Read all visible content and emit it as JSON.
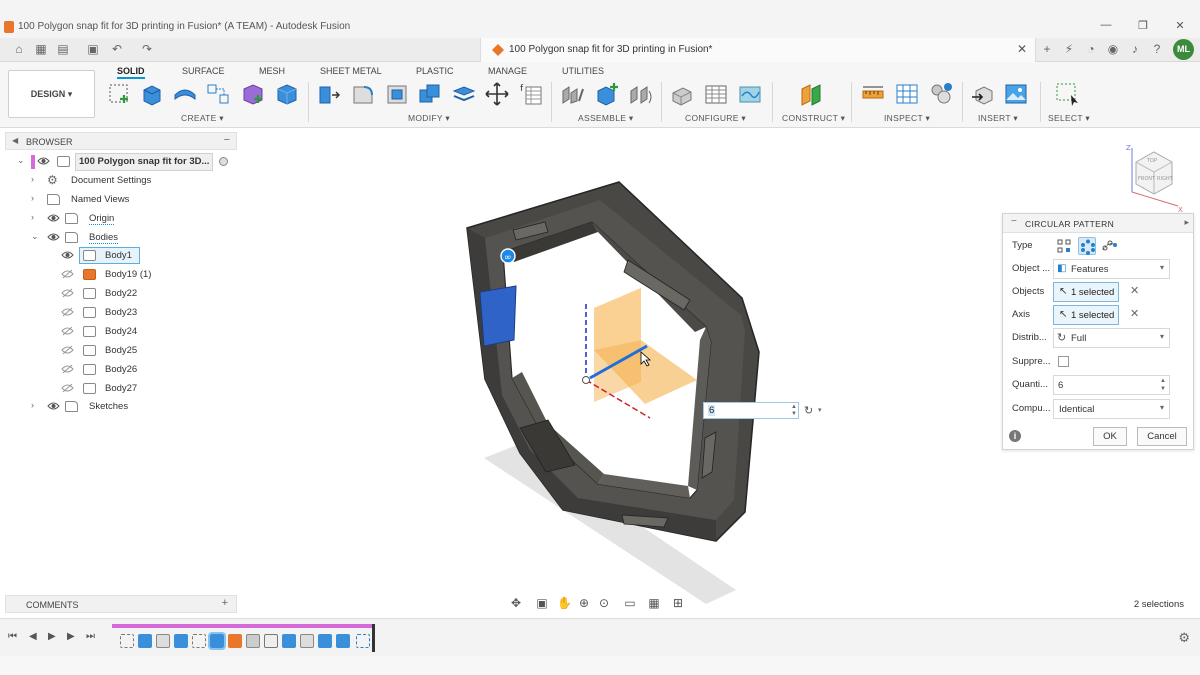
{
  "window": {
    "title": "100 Polygon snap fit for 3D printing in Fusion* (A TEAM) - Autodesk Fusion",
    "controls": {
      "minimize": "—",
      "restore": "❐",
      "close": "✕"
    }
  },
  "doc_tab": {
    "label": "100 Polygon snap fit for 3D printing in Fusion*",
    "close": "✕"
  },
  "user": {
    "initials": "ML"
  },
  "toolbar": {
    "workspace": "DESIGN ▾",
    "tabs": [
      "SOLID",
      "SURFACE",
      "MESH",
      "SHEET METAL",
      "PLASTIC",
      "MANAGE",
      "UTILITIES"
    ],
    "active_tab": "SOLID",
    "groups": [
      "CREATE ▾",
      "MODIFY ▾",
      "ASSEMBLE ▾",
      "CONFIGURE ▾",
      "CONSTRUCT ▾",
      "INSPECT ▾",
      "INSERT ▾",
      "SELECT ▾"
    ]
  },
  "browser": {
    "title": "BROWSER",
    "root": "100 Polygon snap fit for 3D...",
    "items": [
      {
        "label": "Document Settings"
      },
      {
        "label": "Named Views"
      },
      {
        "label": "Origin"
      },
      {
        "label": "Bodies"
      },
      {
        "label": "Body1"
      },
      {
        "label": "Body19 (1)"
      },
      {
        "label": "Body22"
      },
      {
        "label": "Body23"
      },
      {
        "label": "Body24"
      },
      {
        "label": "Body25"
      },
      {
        "label": "Body26"
      },
      {
        "label": "Body27"
      },
      {
        "label": "Sketches"
      }
    ]
  },
  "comments": {
    "label": "COMMENTS",
    "add": "+"
  },
  "dialog": {
    "title": "CIRCULAR PATTERN",
    "rows": {
      "type": "Type",
      "object_type": "Object ...",
      "object_type_value": "Features",
      "objects": "Objects",
      "objects_value": "1 selected",
      "axis": "Axis",
      "axis_value": "1 selected",
      "distribution": "Distrib...",
      "distribution_value": "Full",
      "suppress": "Suppre...",
      "quantity": "Quanti...",
      "quantity_value": "6",
      "compute": "Compu...",
      "compute_value": "Identical"
    },
    "ok": "OK",
    "cancel": "Cancel"
  },
  "canvas": {
    "quantity_input": "6"
  },
  "status": {
    "selections": "2 selections"
  },
  "colors": {
    "accent": "#0696d7",
    "body": "#3f3e3c",
    "selected_face": "#2f63c8",
    "preview": "#f5b04d",
    "timeline": "#d66ad8"
  }
}
